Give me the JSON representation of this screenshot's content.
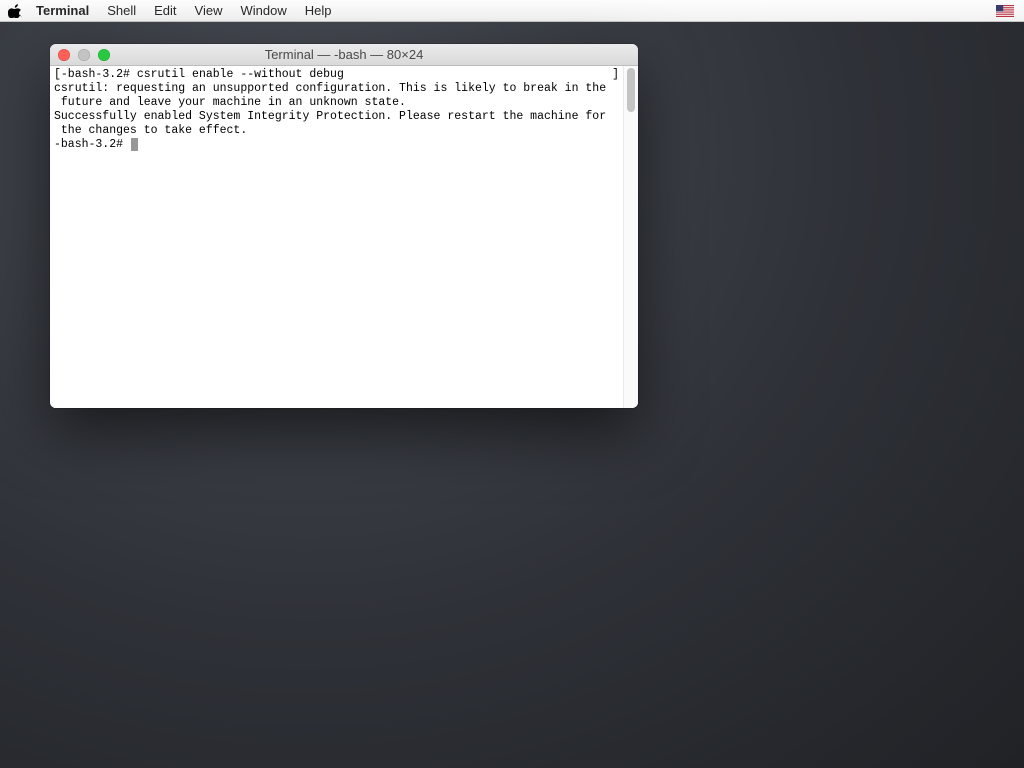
{
  "menubar": {
    "app": "Terminal",
    "items": [
      "Shell",
      "Edit",
      "View",
      "Window",
      "Help"
    ]
  },
  "window": {
    "title": "Terminal — -bash — 80×24"
  },
  "terminal": {
    "prompt1": "-bash-3.2# ",
    "cmd1": "csrutil enable --without debug",
    "out1": "csrutil: requesting an unsupported configuration. This is likely to break in the",
    "out2": " future and leave your machine in an unknown state.",
    "out3": "Successfully enabled System Integrity Protection. Please restart the machine for",
    "out4": " the changes to take effect.",
    "prompt2": "-bash-3.2# "
  }
}
